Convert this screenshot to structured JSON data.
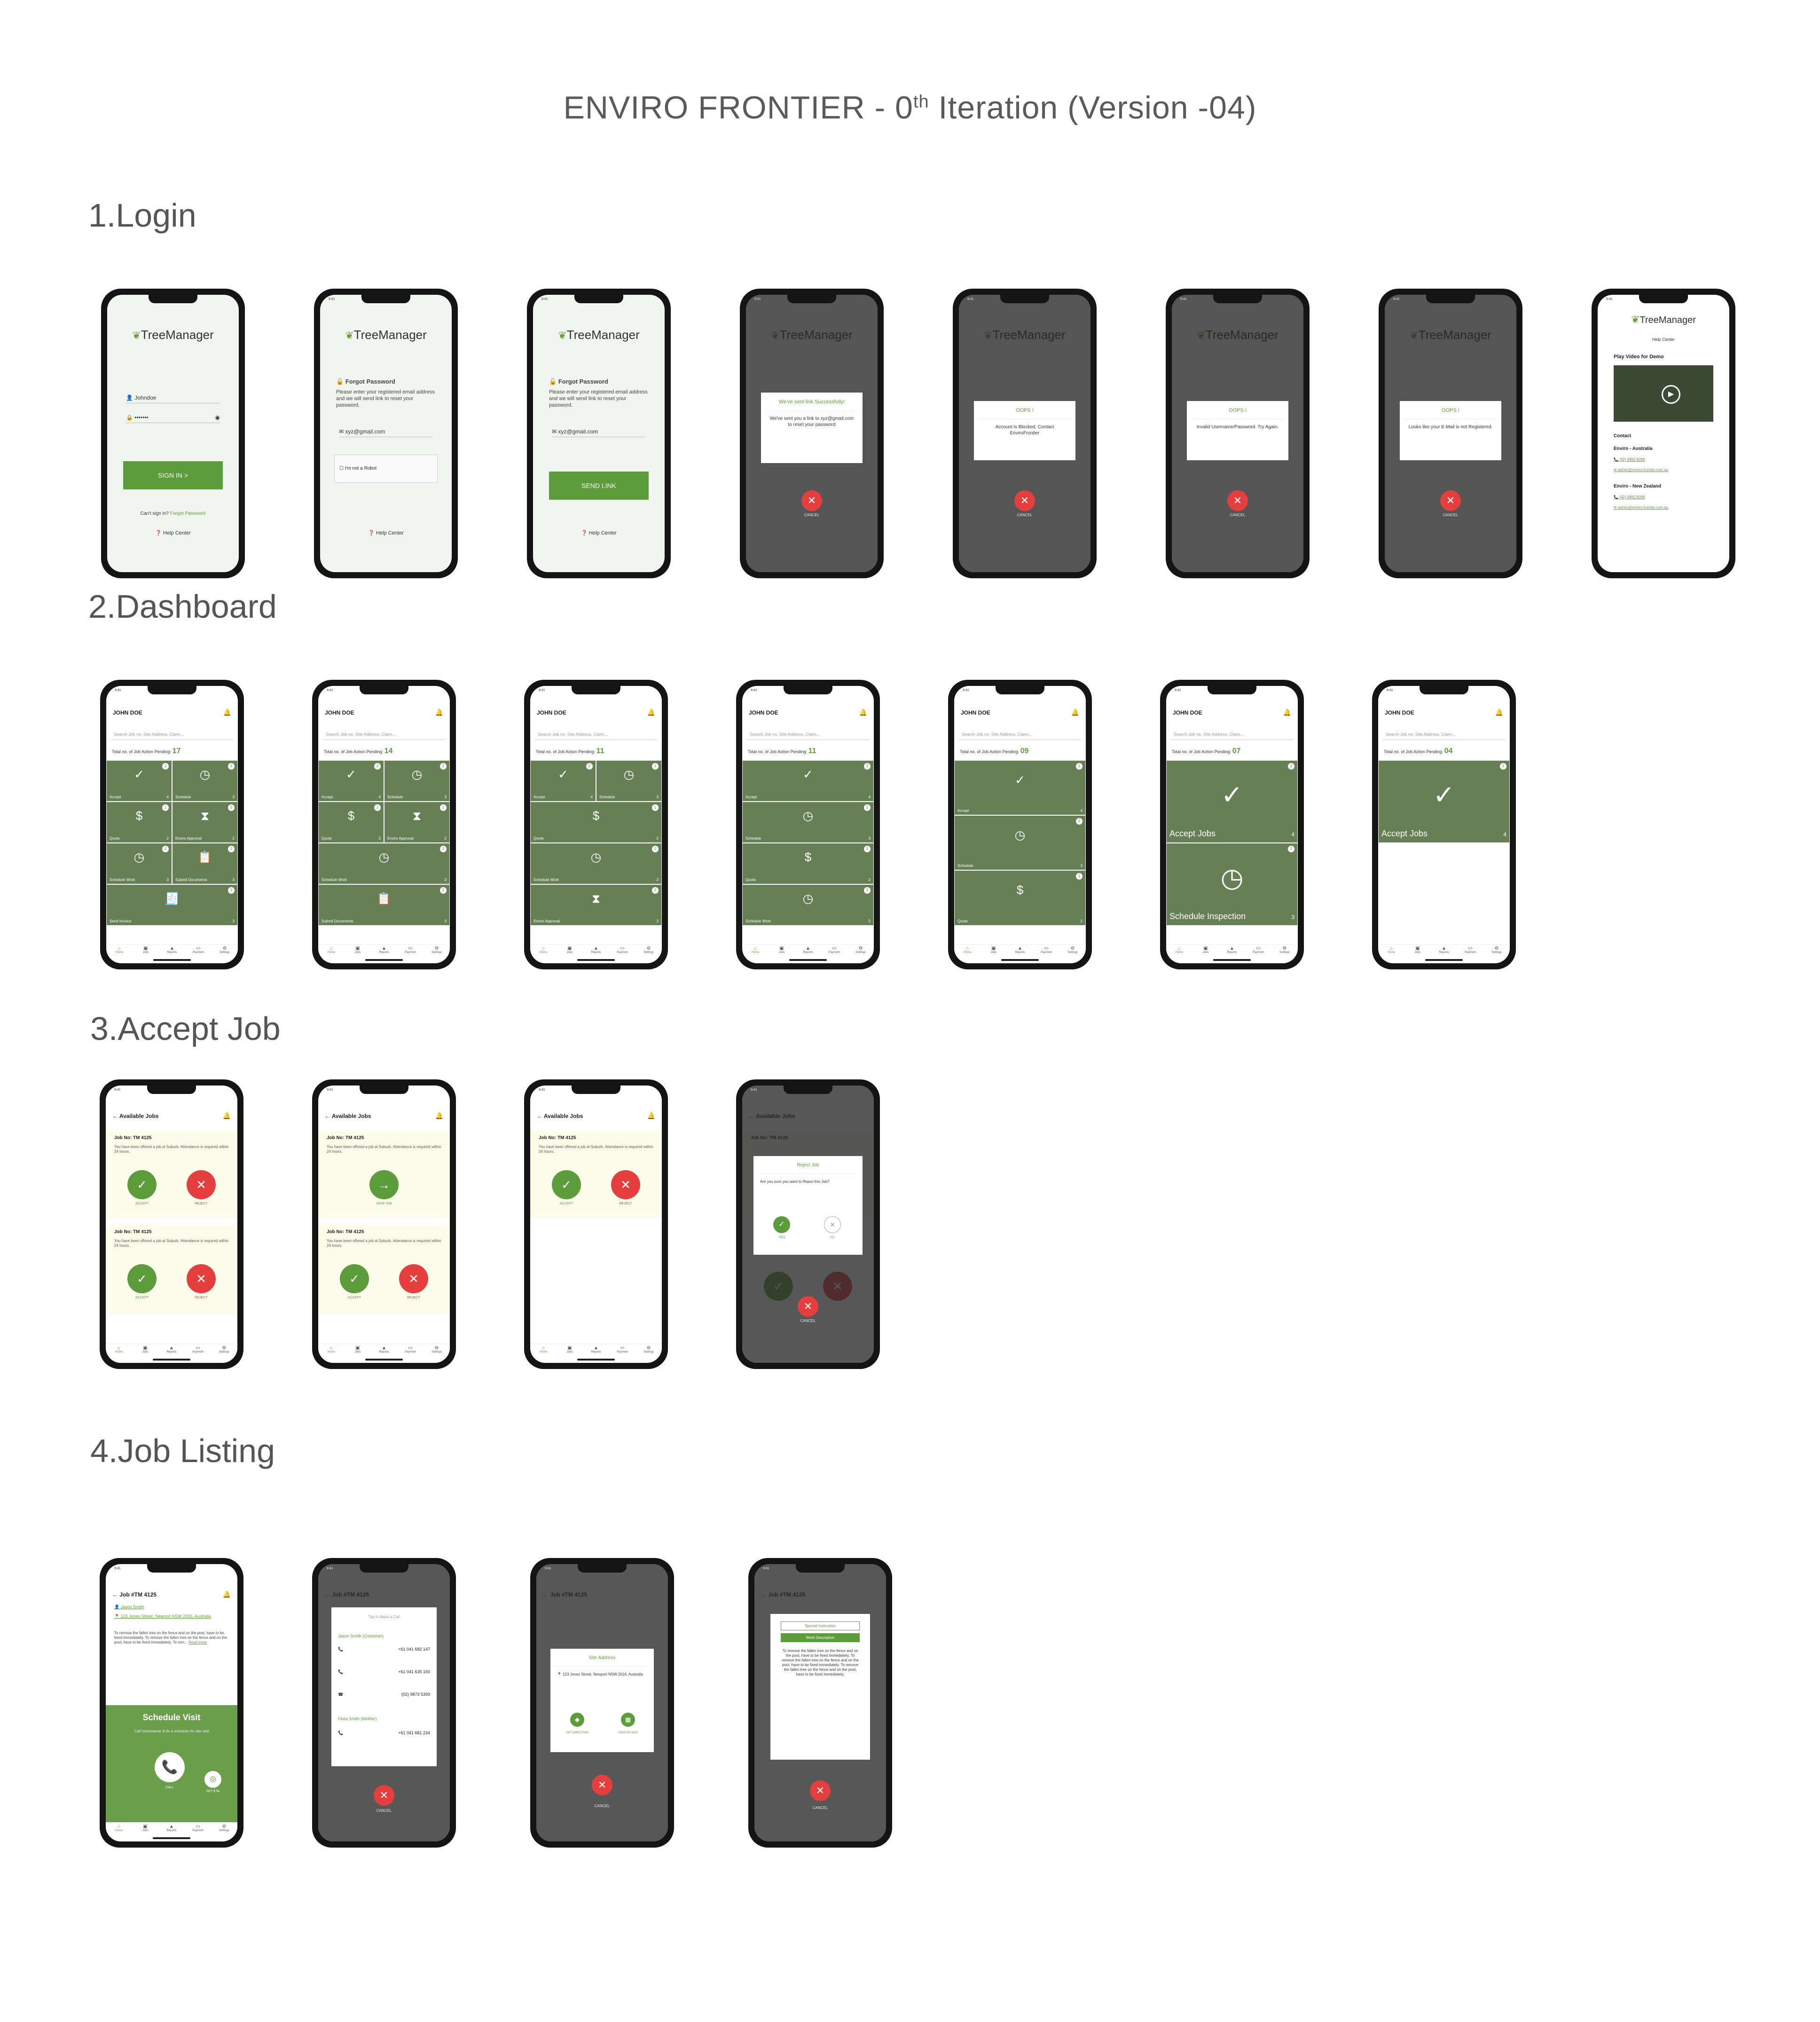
{
  "title": {
    "prefix": "ENVIRO FRONTIER - 0",
    "sup": "th",
    "suffix": " Iteration (Version -04)"
  },
  "sections": {
    "login": "1.Login",
    "dashboard": "2.Dashboard",
    "accept": "3.Accept Job",
    "listing": "4.Job Listing"
  },
  "common": {
    "time": "9:41",
    "logo": "TreeManager",
    "help": "Help Center",
    "cancel": "CANCEL",
    "user": "JOHN DOE",
    "search_ph": "Search Job no. Site Address, Claim...",
    "pending_lbl": "Total no. of Job Action Pending:",
    "tabs": [
      "Home",
      "Jobs",
      "Reports",
      "Payment",
      "Settings"
    ]
  },
  "login": {
    "username": "Johndoe",
    "password": "•••••••",
    "signin": "SIGN IN >",
    "cant": "Can't sign in?",
    "forgot_link": "Forgot Password",
    "forgot_title": "Forgot Password",
    "forgot_desc": "Please enter your registered email address and we will send link to reset your password.",
    "email": "xyz@gmail.com",
    "robot": "I'm not a Robot",
    "send": "SEND LINK",
    "sent_title": "We've sent link Successfully!",
    "sent_body": "We've sent you a link to xyz@gmail.com to reset your password",
    "oops": "OOPS !",
    "blocked": "Account is Blocked. Contact EnviroFrontier",
    "invalid": "Invalid Username/Password. Try Again.",
    "notreg": "Looks like your E-Mail is not Registered.",
    "play": "Play Video for Demo",
    "contact": "Contact",
    "au": "Enviro - Australia",
    "nz": "Enviro - New Zealand",
    "au_phone": "(02) 9982 8288",
    "au_mail": "admin@enviro-frontier.com.au",
    "nz_phone": "(02) 9982 8288",
    "nz_mail": "admin@enviro-frontier.com.au"
  },
  "dashboard": {
    "counts": [
      "17",
      "14",
      "11",
      "11",
      "09",
      "07",
      "04"
    ],
    "t_accept": "Accept",
    "t_schedule": "Schedule",
    "t_quote": "Quote",
    "t_enviro": "Enviro Approval",
    "t_schedwork": "Schedule Work",
    "t_submit": "Submit Documents",
    "t_invoice": "Send Invoice",
    "accept_jobs": "Accept Jobs",
    "sched_insp": "Schedule Inspection"
  },
  "accept": {
    "header": "Available Jobs",
    "job_no": "Job No: TM 4125",
    "job_txt": "You have been offered a job at Suburb. Attendance is required within 24 hours.",
    "accept": "ACCEPT",
    "reject": "REJECT",
    "view": "VIEW JOB",
    "reject_title": "Reject Job",
    "reject_q": "Are you sure you want to Reject this Job?",
    "yes": "YES",
    "no": "NO"
  },
  "listing": {
    "header": "Job #TM 4125",
    "customer": "Jason Smith",
    "address": "123 Jones Street, Newport NSW 2016, Australia",
    "desc": "To remove the fallen tree on the fence and on the pool, have to be fixed immediately. To remove the fallen tree on the fence and on the pool, have to be fixed immediately. To rem...",
    "readmore": "Read more",
    "schedule": "Schedule Visit",
    "call_hint": "Call homeowner & fix a schedule for site visit",
    "call": "CALL",
    "seteta": "SET ETA",
    "tap_call": "Tap to Make a Call",
    "c1": "Jason Smith (Customer)",
    "p1": "+61 041 682 147",
    "p2": "+61 041 635 150",
    "p3": "(02) 9873 5393",
    "c2": "Flora Smith (Mother)",
    "p4": "+61 041 681 234",
    "mobile": "Mobile",
    "home": "Home",
    "site": "Site Address",
    "site_addr": "123 Jones Street, Newport NSW 2016, Australia",
    "dir": "GET DIRECTION",
    "map": "VIEW ON MAP",
    "special": "Special Instruction",
    "work": "Work Description",
    "work_txt": "To remove the fallen tree on the fence and on the pool, have to be fixed immediately. To remove the fallen tree on the fence and on the pool, have to be fixed immediately. To remove the fallen tree on the fence and on the pool, have to be fixed immediately."
  }
}
